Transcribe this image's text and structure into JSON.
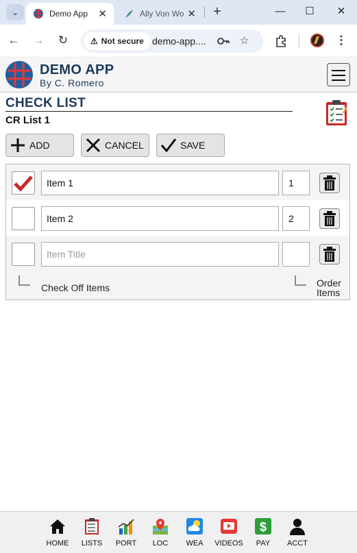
{
  "browser": {
    "tabs": [
      {
        "title": "Demo App",
        "active": true
      },
      {
        "title": "Ally Von Wo",
        "active": false
      }
    ],
    "security_label": "Not secure",
    "url": "demo-app....",
    "new_tab": "+",
    "controls": {
      "minimize": "—",
      "maximize": "☐",
      "close": "✕"
    }
  },
  "app": {
    "title": "DEMO APP",
    "subtitle": "By C. Romero"
  },
  "page": {
    "title": "CHECK LIST",
    "list_name": "CR List 1"
  },
  "actions": {
    "add": "ADD",
    "cancel": "CANCEL",
    "save": "SAVE"
  },
  "items": [
    {
      "checked": true,
      "title": "Item 1",
      "order": "1"
    },
    {
      "checked": false,
      "title": "Item 2",
      "order": "2"
    }
  ],
  "new_item": {
    "title_placeholder": "Item Title",
    "title": "",
    "order": ""
  },
  "hints": {
    "check_off": "Check Off Items",
    "order_line1": "Order",
    "order_line2": "Items"
  },
  "nav": [
    {
      "label": "HOME",
      "icon": "home-icon"
    },
    {
      "label": "LISTS",
      "icon": "lists-icon"
    },
    {
      "label": "PORT",
      "icon": "portfolio-icon"
    },
    {
      "label": "LOC",
      "icon": "location-icon"
    },
    {
      "label": "WEA",
      "icon": "weather-icon"
    },
    {
      "label": "VIDEOS",
      "icon": "videos-icon"
    },
    {
      "label": "PAY",
      "icon": "pay-icon"
    },
    {
      "label": "ACCT",
      "icon": "account-icon"
    }
  ],
  "colors": {
    "brand": "#1b3a5c",
    "check": "#c62828",
    "tab_bar": "#dfe7f5"
  }
}
